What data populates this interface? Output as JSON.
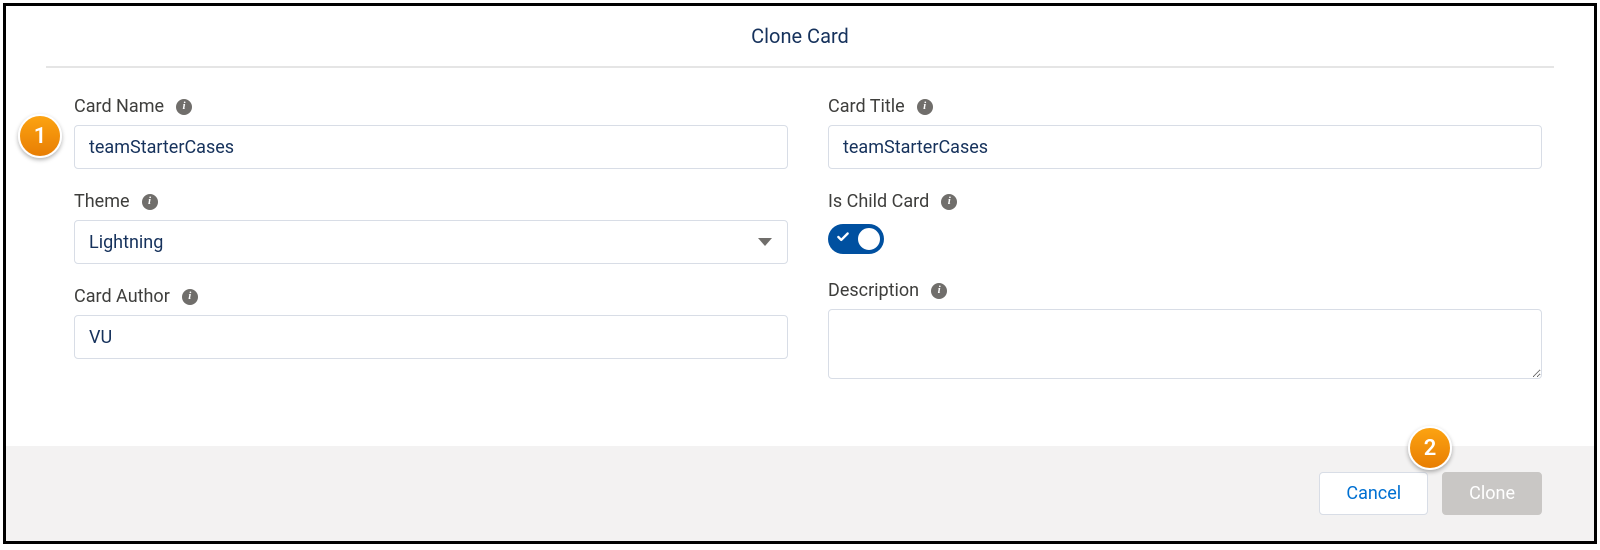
{
  "title": "Clone Card",
  "callouts": {
    "one": "1",
    "two": "2"
  },
  "left": {
    "card_name": {
      "label": "Card Name",
      "value": "teamStarterCases"
    },
    "theme": {
      "label": "Theme",
      "value": "Lightning"
    },
    "card_author": {
      "label": "Card Author",
      "value": "VU"
    }
  },
  "right": {
    "card_title": {
      "label": "Card Title",
      "value": "teamStarterCases"
    },
    "is_child": {
      "label": "Is Child Card",
      "on": true
    },
    "description": {
      "label": "Description",
      "value": ""
    }
  },
  "footer": {
    "cancel": "Cancel",
    "clone": "Clone"
  }
}
